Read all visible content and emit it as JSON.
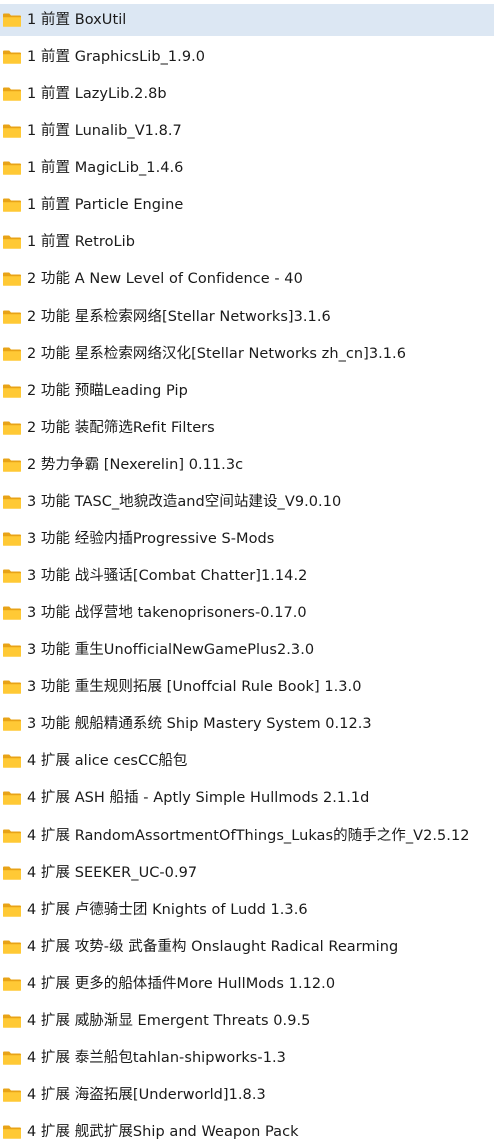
{
  "colors": {
    "folder_front": "#ffc935",
    "folder_back": "#e8a317",
    "selection": "#dce7f3",
    "text": "#1a1a1a"
  },
  "icon": "folder-icon",
  "items": [
    {
      "name": "1 前置 BoxUtil",
      "selected": true
    },
    {
      "name": "1 前置 GraphicsLib_1.9.0"
    },
    {
      "name": "1 前置 LazyLib.2.8b"
    },
    {
      "name": "1 前置 Lunalib_V1.8.7"
    },
    {
      "name": "1 前置 MagicLib_1.4.6"
    },
    {
      "name": "1 前置 Particle Engine"
    },
    {
      "name": "1 前置 RetroLib"
    },
    {
      "name": "2 功能 A New Level of Confidence - 40"
    },
    {
      "name": "2 功能 星系检索网络[Stellar Networks]3.1.6"
    },
    {
      "name": "2 功能 星系检索网络汉化[Stellar Networks zh_cn]3.1.6"
    },
    {
      "name": "2 功能 预瞄Leading Pip"
    },
    {
      "name": "2 功能 装配筛选Refit Filters"
    },
    {
      "name": "2 势力争霸 [Nexerelin] 0.11.3c"
    },
    {
      "name": "3 功能 TASC_地貌改造and空间站建设_V9.0.10"
    },
    {
      "name": "3 功能 经验内插Progressive S-Mods"
    },
    {
      "name": "3 功能 战斗骚话[Combat Chatter]1.14.2"
    },
    {
      "name": "3 功能 战俘营地 takenoprisoners-0.17.0"
    },
    {
      "name": "3 功能 重生UnofficialNewGamePlus2.3.0"
    },
    {
      "name": "3 功能 重生规则拓展 [Unoffcial Rule Book] 1.3.0"
    },
    {
      "name": "3 功能 舰船精通系统 Ship Mastery System 0.12.3"
    },
    {
      "name": "4 扩展 alice cesCC船包"
    },
    {
      "name": "4 扩展 ASH 船插 - Aptly Simple Hullmods 2.1.1d"
    },
    {
      "name": "4 扩展 RandomAssortmentOfThings_Lukas的随手之作_V2.5.12"
    },
    {
      "name": "4 扩展 SEEKER_UC-0.97"
    },
    {
      "name": "4 扩展 卢德骑士团 Knights of Ludd 1.3.6"
    },
    {
      "name": "4 扩展 攻势-级 武备重构 Onslaught Radical Rearming"
    },
    {
      "name": "4 扩展 更多的船体插件More HullMods 1.12.0"
    },
    {
      "name": "4 扩展 威胁渐显 Emergent Threats 0.9.5"
    },
    {
      "name": "4 扩展 泰兰船包tahlan-shipworks-1.3"
    },
    {
      "name": "4 扩展 海盗拓展[Underworld]1.8.3"
    },
    {
      "name": "4 扩展 舰武扩展Ship and Weapon Pack"
    }
  ]
}
